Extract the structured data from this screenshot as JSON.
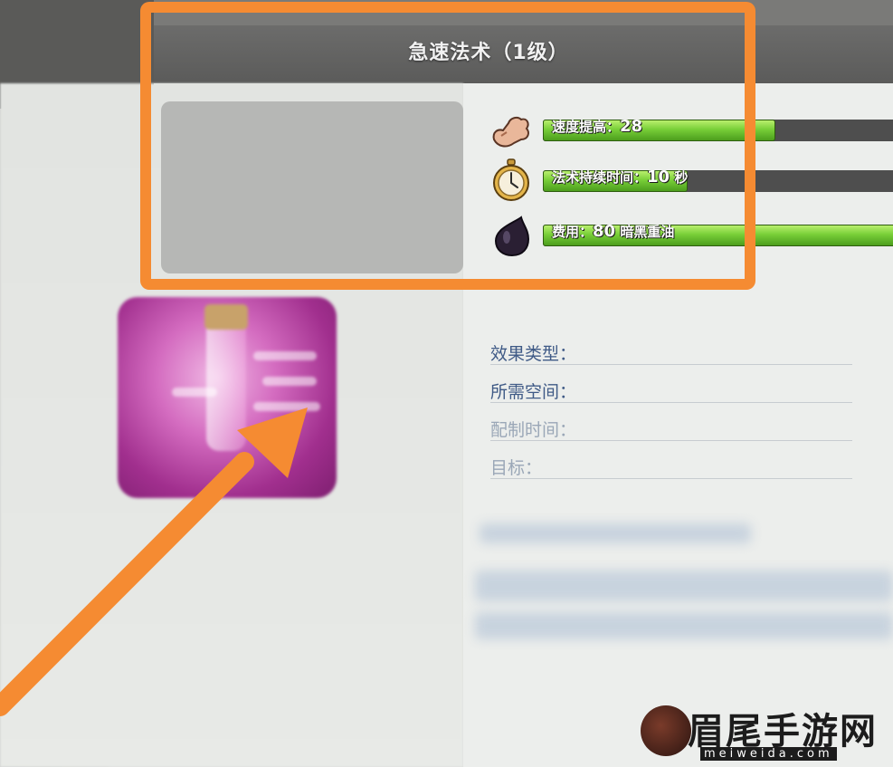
{
  "header": {
    "title": "急速法术（1级）"
  },
  "stats": [
    {
      "icon": "muscle-arm-icon",
      "label": "速度提高：",
      "value": "28",
      "unit": "",
      "fill_fraction": 0.66
    },
    {
      "icon": "stopwatch-icon",
      "label": "法术持续时间：",
      "value": "10",
      "unit": "秒",
      "fill_fraction": 0.41
    },
    {
      "icon": "dark-elixir-drop-icon",
      "label": "费用：",
      "value": "80",
      "unit": "暗黑重油",
      "fill_fraction": 1.0
    }
  ],
  "info": [
    {
      "label": "效果类型："
    },
    {
      "label": "所需空间："
    },
    {
      "label": "配制时间："
    },
    {
      "label": "目标："
    }
  ],
  "spell_card": {
    "icon": "haste-potion-icon"
  },
  "annotation": {
    "color": "#f58b32"
  },
  "watermark": {
    "brand": "眉尾手游网",
    "domain": "meiweida.com"
  }
}
